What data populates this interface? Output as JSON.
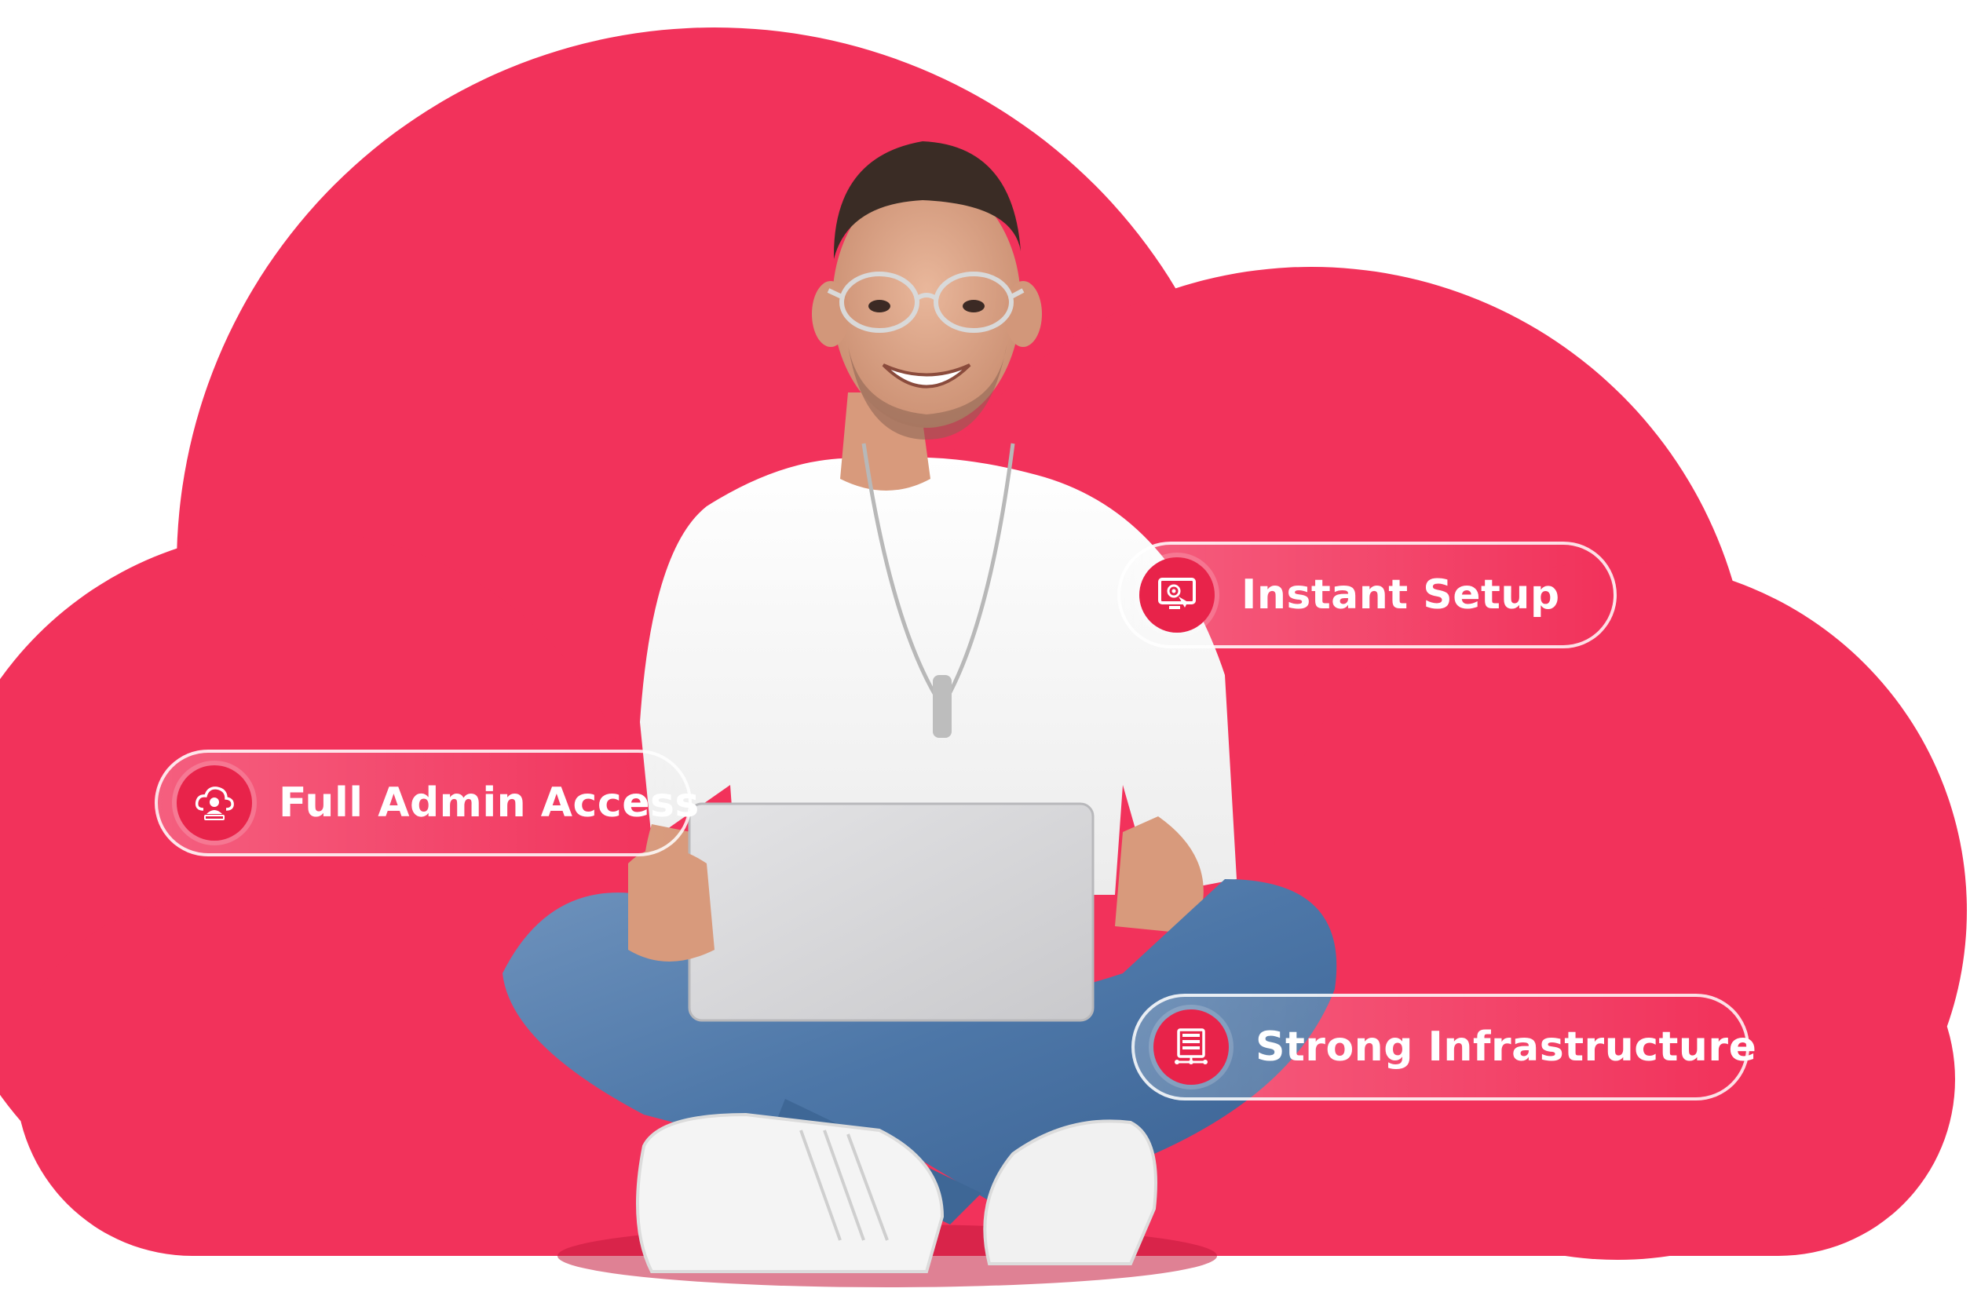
{
  "colors": {
    "cloud": "#f2325b",
    "icon_bg": "#e8234a",
    "text": "#ffffff"
  },
  "features": [
    {
      "label": "Instant Setup",
      "icon": "monitor-setup-icon"
    },
    {
      "label": "Full Admin Access",
      "icon": "cloud-user-icon"
    },
    {
      "label": "Strong Infrastructure",
      "icon": "server-network-icon"
    }
  ]
}
